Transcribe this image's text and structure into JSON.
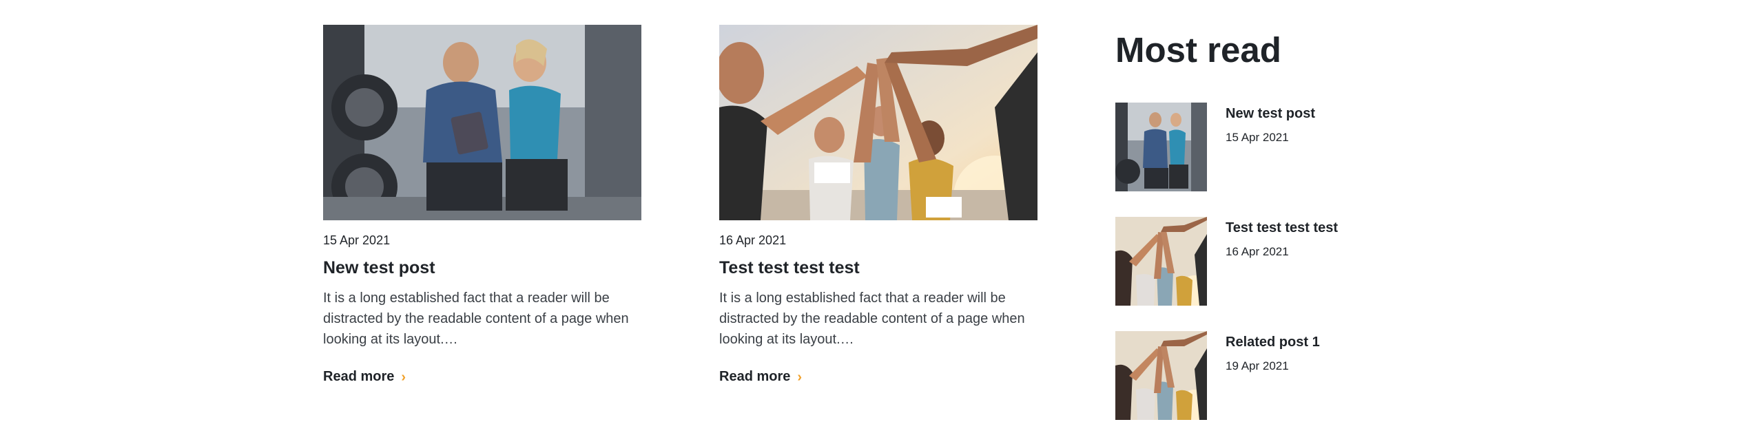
{
  "posts": [
    {
      "date": "15 Apr 2021",
      "title": "New test post",
      "excerpt": "It is a long established fact that a reader will be distracted by the readable content of a page when looking at its layout.…",
      "read_more": "Read more",
      "image": "gym-couple-tablet-photo"
    },
    {
      "date": "16 Apr 2021",
      "title": "Test test test test",
      "excerpt": "It is a long established fact that a reader will be distracted by the readable content of a page when looking at its layout.…",
      "read_more": "Read more",
      "image": "runners-high-five-photo"
    }
  ],
  "sidebar": {
    "title": "Most read",
    "items": [
      {
        "title": "New test post",
        "date": "15 Apr 2021",
        "image": "gym-couple-tablet-photo"
      },
      {
        "title": "Test test test test",
        "date": "16 Apr 2021",
        "image": "runners-high-five-photo"
      },
      {
        "title": "Related post 1",
        "date": "19 Apr 2021",
        "image": "runners-high-five-photo"
      }
    ]
  },
  "icons": {
    "read_more_chevron": "chevron-right-icon"
  },
  "colors": {
    "text": "#1f2328",
    "accent": "#f1a12a"
  }
}
